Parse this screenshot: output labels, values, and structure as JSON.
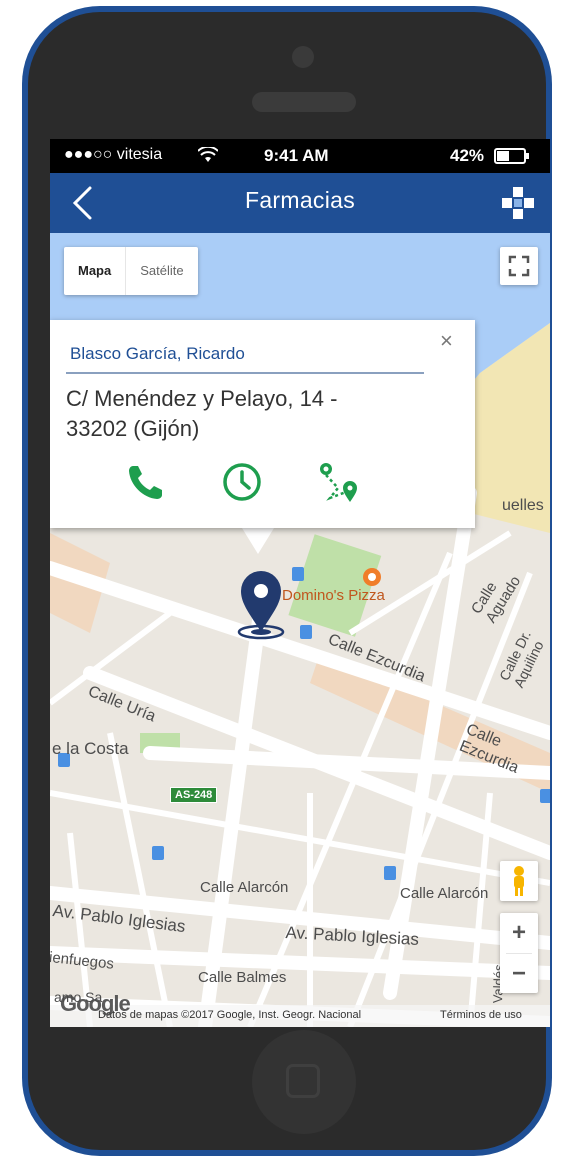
{
  "status_bar": {
    "carrier": "●●●○○ vitesia",
    "time": "9:41 AM",
    "battery": "42%"
  },
  "nav": {
    "title": "Farmacias",
    "back_icon": "chevron-left-icon",
    "logo_icon": "pharmacy-cross-icon"
  },
  "map_controls": {
    "map_type_selected": "Mapa",
    "map_type_other": "Satélite"
  },
  "info_window": {
    "name": "Blasco García, Ricardo",
    "address_line1": "C/ Menéndez y Pelayo, 14 -",
    "address_line2": "33202 (Gijón)",
    "close_symbol": "×",
    "action_icons": [
      "phone-icon",
      "clock-icon",
      "route-icon"
    ],
    "accent_color": "#1e9e4e"
  },
  "map_labels": {
    "poi": "Domino's Pizza",
    "calle_aguado": "Calle Aguado",
    "calle_dr_aquilino": "Calle Dr. Aquilino",
    "calle_ezcurdia": "Calle Ezcurdia",
    "calle_ezcurdia_2": "Calle Ezcurdia",
    "calle_uria": "Calle Uría",
    "la_costa": "e la Costa",
    "road_shield": "AS-248",
    "calle_alarcon": "Calle Alarcón",
    "calle_alarcon_2": "Calle Alarcón",
    "av_pablo_iglesias": "Av. Pablo Iglesias",
    "av_pablo_iglesias_2": "Av. Pablo Iglesias",
    "cienfuegos": "ienfuegos",
    "calle_balmes": "Calle Balmes",
    "valdes": "Valdés",
    "fragment_top": "uelles",
    "fragment_bottom": "amo Sa"
  },
  "attribution": {
    "logo": "Google",
    "data": "Datos de mapas ©2017 Google, Inst. Geogr. Nacional",
    "terms": "Términos de uso"
  },
  "colors": {
    "brand_blue": "#1f4f95",
    "marker": "#223a6e",
    "green_action": "#1e9e4e"
  }
}
